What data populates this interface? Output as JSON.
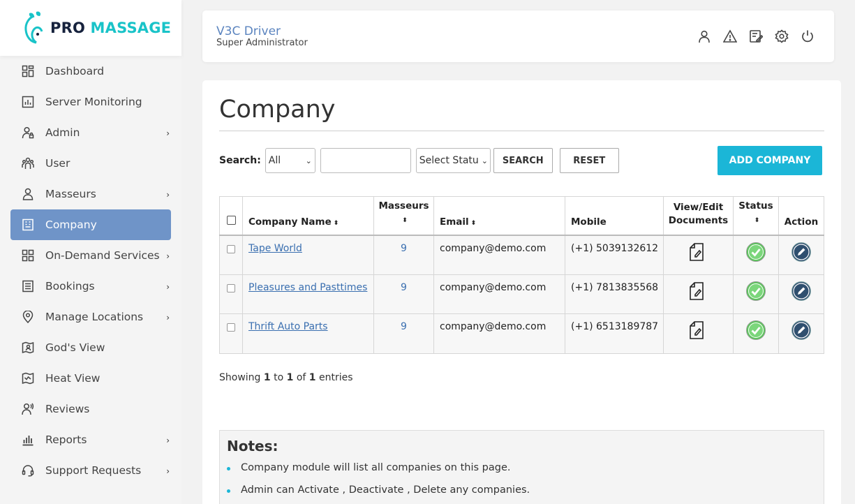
{
  "brand": {
    "pro": "PRO",
    "massage": "MASSAGE"
  },
  "sidebar": {
    "items": [
      {
        "label": "Dashboard",
        "icon": "dashboard-icon",
        "chevron": false,
        "active": false
      },
      {
        "label": "Server Monitoring",
        "icon": "monitor-icon",
        "chevron": false,
        "active": false
      },
      {
        "label": "Admin",
        "icon": "admin-user-icon",
        "chevron": true,
        "active": false
      },
      {
        "label": "User",
        "icon": "users-icon",
        "chevron": false,
        "active": false
      },
      {
        "label": "Masseurs",
        "icon": "person-icon",
        "chevron": true,
        "active": false
      },
      {
        "label": "Company",
        "icon": "building-icon",
        "chevron": false,
        "active": true
      },
      {
        "label": "On-Demand Services",
        "icon": "grid-icon",
        "chevron": true,
        "active": false
      },
      {
        "label": "Bookings",
        "icon": "list-icon",
        "chevron": true,
        "active": false
      },
      {
        "label": "Manage Locations",
        "icon": "location-pin-icon",
        "chevron": true,
        "active": false
      },
      {
        "label": "God's View",
        "icon": "map-view-icon",
        "chevron": false,
        "active": false
      },
      {
        "label": "Heat View",
        "icon": "heat-map-icon",
        "chevron": false,
        "active": false
      },
      {
        "label": "Reviews",
        "icon": "reviews-icon",
        "chevron": false,
        "active": false
      },
      {
        "label": "Reports",
        "icon": "bar-chart-icon",
        "chevron": true,
        "active": false
      },
      {
        "label": "Support Requests",
        "icon": "headset-icon",
        "chevron": true,
        "active": false
      }
    ],
    "chevron": "›"
  },
  "header": {
    "name": "V3C Driver",
    "role": "Super Administrator",
    "icons": [
      "profile-icon",
      "warning-icon",
      "edit-note-icon",
      "settings-icon",
      "power-icon"
    ]
  },
  "page": {
    "title": "Company"
  },
  "search": {
    "label": "Search:",
    "field_select": "All",
    "text_value": "",
    "status_select": "Select Statu",
    "search_button": "SEARCH",
    "reset_button": "RESET",
    "add_button": "ADD COMPANY"
  },
  "table": {
    "columns": {
      "name": "Company Name",
      "masseurs": "Masseurs",
      "email": "Email",
      "mobile": "Mobile",
      "docs_line1": "View/Edit",
      "docs_line2": "Documents",
      "status": "Status",
      "action": "Action"
    },
    "sort_glyph": "⬍",
    "rows": [
      {
        "name": "Tape World",
        "masseurs": "9",
        "email": "company@demo.com",
        "mobile": "(+1) 5039132612"
      },
      {
        "name": "Pleasures and Pasttimes",
        "masseurs": "9",
        "email": "company@demo.com",
        "mobile": "(+1) 7813835568"
      },
      {
        "name": "Thrift Auto Parts",
        "masseurs": "9",
        "email": "company@demo.com",
        "mobile": "(+1) 6513189787"
      }
    ]
  },
  "pagination": {
    "showing": "Showing",
    "from": "1",
    "to_word": "to",
    "to": "1",
    "of_word": "of",
    "total": "1",
    "entries": "entries"
  },
  "notes": {
    "title": "Notes:",
    "items": [
      "Company module will list all companies on this page.",
      "Admin can Activate , Deactivate , Delete any companies."
    ]
  },
  "colors": {
    "accent": "#1bb6d7",
    "active_nav": "#6f94c8",
    "status_active": "#5cc55c",
    "action_edit": "#2f4f6f"
  }
}
